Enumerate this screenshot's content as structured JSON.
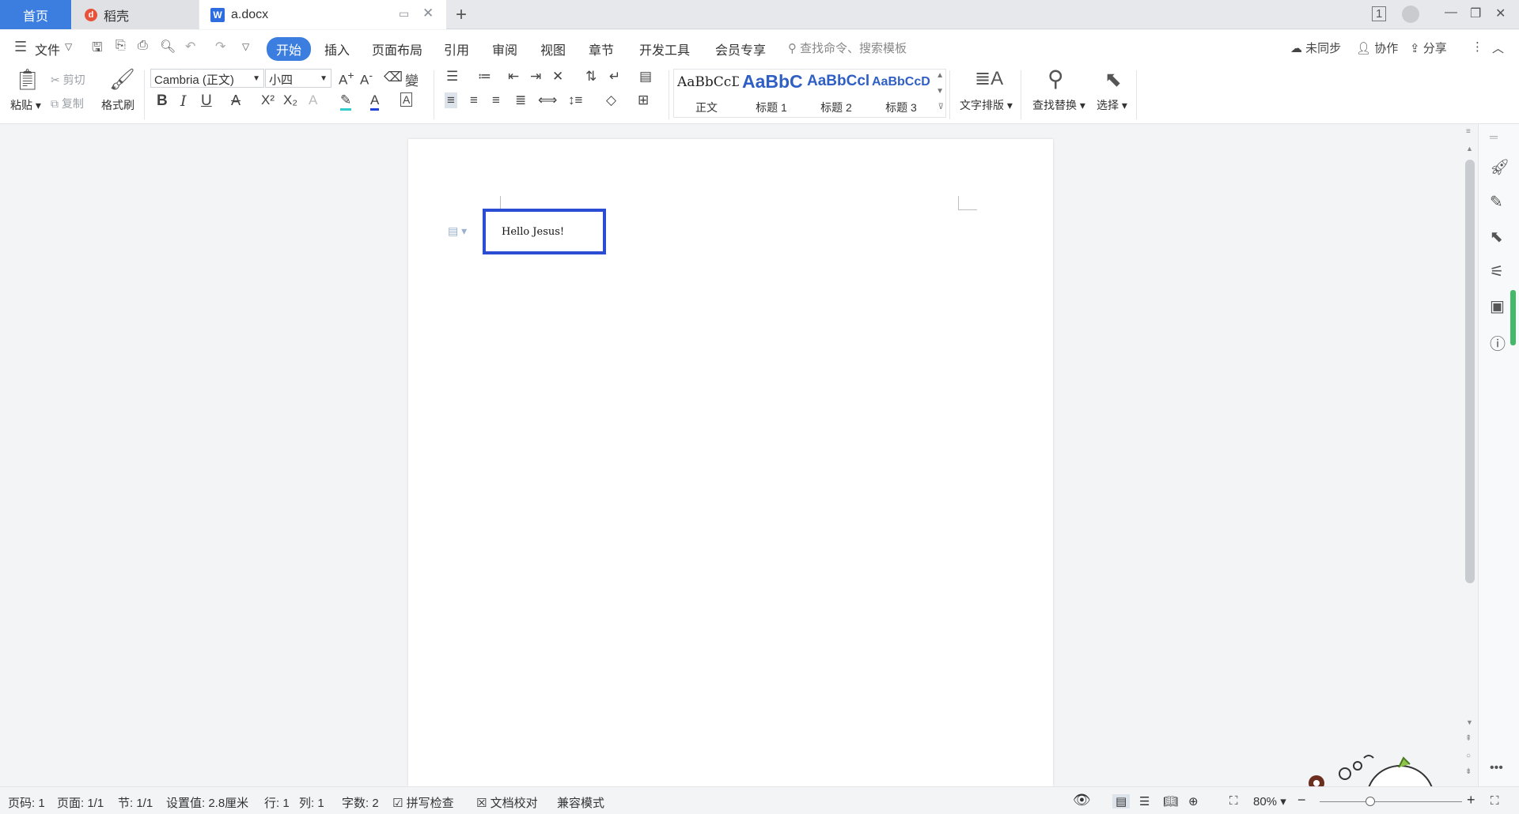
{
  "tabs": {
    "home": "首页",
    "daoke": "稻壳",
    "document": "a.docx"
  },
  "menu": {
    "file": "文件",
    "items": [
      "开始",
      "插入",
      "页面布局",
      "引用",
      "审阅",
      "视图",
      "章节",
      "开发工具",
      "会员专享"
    ],
    "search_placeholder": "查找命令、搜索模板",
    "sync": "未同步",
    "collaborate": "协作",
    "share": "分享"
  },
  "ribbon": {
    "paste": "粘贴",
    "cut": "剪切",
    "copy": "复制",
    "format_painter": "格式刷",
    "font_name": "Cambria (正文)",
    "font_size": "小四",
    "styles": [
      {
        "sample": "AaBbCcD",
        "label": "正文"
      },
      {
        "sample": "AaBbC",
        "label": "标题 1"
      },
      {
        "sample": "AaBbCcl",
        "label": "标题 2"
      },
      {
        "sample": "AaBbCcD",
        "label": "标题 3"
      }
    ],
    "text_layout": "文字排版",
    "find_replace": "查找替换",
    "select": "选择"
  },
  "document": {
    "textbox_content": "Hello Jesus!"
  },
  "status": {
    "page_num": "页码: 1",
    "pages": "页面: 1/1",
    "section": "节: 1/1",
    "setting": "设置值: 2.8厘米",
    "row": "行: 1",
    "col": "列: 1",
    "word_count": "字数: 2",
    "spell_check": "拼写检查",
    "doc_proof": "文档校对",
    "compat_mode": "兼容模式",
    "zoom": "80%"
  },
  "colors": {
    "accent": "#3b7ee0",
    "textbox_border": "#2b4dd4",
    "heading_style": "#2f5fc4"
  }
}
